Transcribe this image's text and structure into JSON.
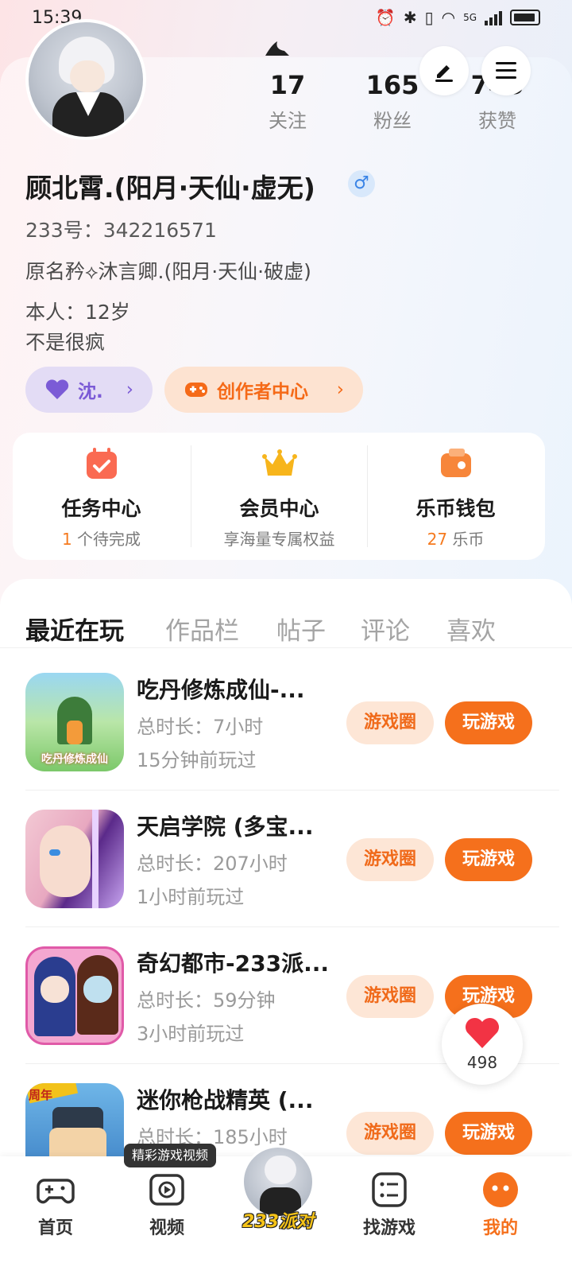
{
  "status_bar": {
    "time": "15:39",
    "network": "5G"
  },
  "profile": {
    "stats": [
      {
        "value": "17",
        "label": "关注"
      },
      {
        "value": "165",
        "label": "粉丝"
      },
      {
        "value": "745",
        "label": "获赞"
      }
    ],
    "nickname": "顾北霄.(阳月·天仙·虚无)",
    "gender_symbol": "♂",
    "id_line": "233号：342216571",
    "bio_line1": "原名矜⟡沐言卿.(阳月·天仙·破虚)",
    "bio_line2": "本人：12岁",
    "bio_line3": "不是很疯",
    "tag_purple": "沈.",
    "tag_orange": "创作者中心"
  },
  "services": [
    {
      "title": "任务中心",
      "sub_highlight": "1",
      "sub_rest": " 个待完成"
    },
    {
      "title": "会员中心",
      "sub_highlight": "",
      "sub_rest": "享海量专属权益"
    },
    {
      "title": "乐币钱包",
      "sub_highlight": "27",
      "sub_rest": " 乐币"
    }
  ],
  "tabs": [
    "最近在玩",
    "作品栏",
    "帖子",
    "评论",
    "喜欢"
  ],
  "games": [
    {
      "title": "吃丹修炼成仙-...",
      "duration": "总时长：7小时",
      "last_played": "15分钟前玩过",
      "circle_label": "游戏圈",
      "play_label": "玩游戏",
      "icon_text": "吃丹修炼成仙"
    },
    {
      "title": "天启学院 (多宝...",
      "duration": "总时长：207小时",
      "last_played": "1小时前玩过",
      "circle_label": "游戏圈",
      "play_label": "玩游戏",
      "icon_text": ""
    },
    {
      "title": "奇幻都市-233派...",
      "duration": "总时长：59分钟",
      "last_played": "3小时前玩过",
      "circle_label": "游戏圈",
      "play_label": "玩游戏",
      "icon_text": ""
    },
    {
      "title": "迷你枪战精英 (...",
      "duration": "总时长：185小时",
      "last_played": "",
      "circle_label": "游戏圈",
      "play_label": "玩游戏",
      "icon_text": "周年"
    }
  ],
  "like_float": {
    "count": "498"
  },
  "bottom_nav": {
    "tooltip": "精彩游戏视频",
    "items": [
      "首页",
      "视频",
      "找游戏",
      "我的"
    ],
    "center_label": "233派对"
  },
  "colors": {
    "accent": "#f5701c",
    "purple": "#7b5bd6",
    "gender_blue": "#3a84e6"
  }
}
